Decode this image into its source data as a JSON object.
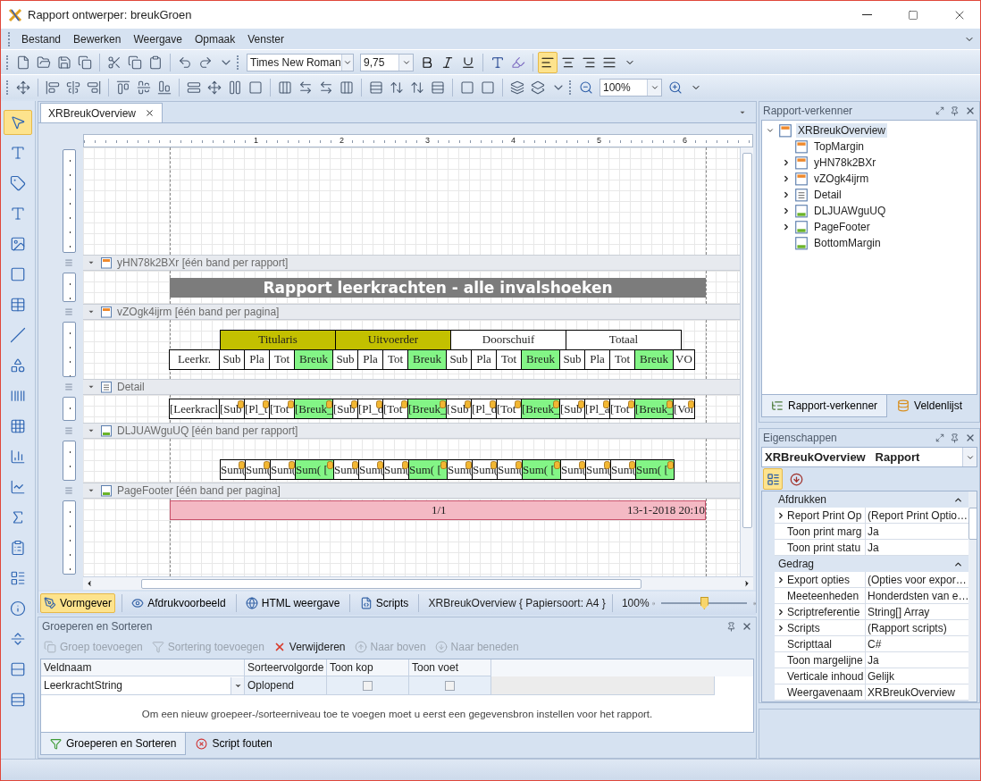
{
  "window": {
    "title": "Rapport ontwerper: breukGroen"
  },
  "menu": [
    "Bestand",
    "Bewerken",
    "Weergave",
    "Opmaak",
    "Venster"
  ],
  "toolbar": {
    "font": "Times New Roman",
    "size": "9,75",
    "zoom": "100%",
    "align_buttons": [
      {
        "selected": true
      },
      {
        "selected": false
      },
      {
        "selected": false
      },
      {
        "selected": false
      }
    ]
  },
  "toolbox": [
    {
      "selected": true
    },
    {
      "selected": false
    },
    {
      "selected": false
    },
    {
      "selected": false
    },
    {
      "selected": false
    },
    {
      "selected": false
    },
    {
      "selected": false
    },
    {
      "selected": false
    },
    {
      "selected": false
    },
    {
      "selected": false
    },
    {
      "selected": false
    },
    {
      "selected": false
    },
    {
      "selected": false
    },
    {
      "selected": false
    },
    {
      "selected": false
    },
    {
      "selected": false
    },
    {
      "selected": false
    },
    {
      "selected": false
    },
    {
      "selected": false
    },
    {
      "selected": false
    }
  ],
  "document_tab": "XRBreukOverview",
  "ruler": [
    "1",
    "2",
    "3",
    "4",
    "5",
    "6"
  ],
  "bands": [
    {
      "kind": "top-margin"
    },
    {
      "kind": "report-header",
      "label": "yHN78k2BXr [één band per rapport]",
      "title": "Rapport leerkrachten - alle invalshoeken"
    },
    {
      "kind": "page-header",
      "label": "vZOgk4ijrm [één band per pagina]",
      "groups": [
        {
          "label": "Titularis",
          "color": "#c3c000"
        },
        {
          "label": "Uitvoerder",
          "color": "#c3c000"
        },
        {
          "label": "Doorschuif",
          "color": "#ffffff"
        },
        {
          "label": "Totaal",
          "color": "#ffffff"
        }
      ],
      "cells": [
        {
          "text": "Leerkr.",
          "kind": "name"
        },
        {
          "text": "Sub",
          "kind": "value"
        },
        {
          "text": "Pla",
          "kind": "value"
        },
        {
          "text": "Tot",
          "kind": "value"
        },
        {
          "text": "Breuk",
          "kind": "fraction"
        },
        {
          "text": "Sub",
          "kind": "value"
        },
        {
          "text": "Pla",
          "kind": "value"
        },
        {
          "text": "Tot",
          "kind": "value"
        },
        {
          "text": "Breuk",
          "kind": "fraction"
        },
        {
          "text": "Sub",
          "kind": "value"
        },
        {
          "text": "Pla",
          "kind": "value"
        },
        {
          "text": "Tot",
          "kind": "value"
        },
        {
          "text": "Breuk",
          "kind": "fraction"
        },
        {
          "text": "Sub",
          "kind": "value"
        },
        {
          "text": "Pla",
          "kind": "value"
        },
        {
          "text": "Tot",
          "kind": "value"
        },
        {
          "text": "Breuk",
          "kind": "fraction"
        },
        {
          "text": "VO",
          "kind": "extra"
        }
      ]
    },
    {
      "kind": "detail",
      "label": "Detail",
      "cells": [
        {
          "text": "[Leerkracl",
          "kind": "name"
        },
        {
          "text": "[Sub",
          "kind": "value"
        },
        {
          "text": "[Pl_t",
          "kind": "value"
        },
        {
          "text": "[Tot",
          "kind": "value"
        },
        {
          "text": "[Breuk_",
          "kind": "fraction"
        },
        {
          "text": "[Sub",
          "kind": "value"
        },
        {
          "text": "[Pl_d",
          "kind": "value"
        },
        {
          "text": "[Tot",
          "kind": "value"
        },
        {
          "text": "[Breuk_",
          "kind": "fraction"
        },
        {
          "text": "[Sub",
          "kind": "value"
        },
        {
          "text": "[Pl_d",
          "kind": "value"
        },
        {
          "text": "[Tot",
          "kind": "value"
        },
        {
          "text": "[Breuk_",
          "kind": "fraction"
        },
        {
          "text": "[Sub",
          "kind": "value"
        },
        {
          "text": "[Pl_a",
          "kind": "value"
        },
        {
          "text": "[Tot",
          "kind": "value"
        },
        {
          "text": "[Breuk_",
          "kind": "fraction"
        },
        {
          "text": "[Vol",
          "kind": "extra"
        }
      ]
    },
    {
      "kind": "report-footer",
      "label": "DLJUAWguUQ [één band per rapport]",
      "cells": [
        {
          "text": "Sum(",
          "kind": "value"
        },
        {
          "text": "Sum(",
          "kind": "value"
        },
        {
          "text": "Sum(",
          "kind": "value"
        },
        {
          "text": "Sum( [",
          "kind": "fraction"
        },
        {
          "text": "Sum(",
          "kind": "value"
        },
        {
          "text": "Sum(",
          "kind": "value"
        },
        {
          "text": "Sum(",
          "kind": "value"
        },
        {
          "text": "Sum( [",
          "kind": "fraction"
        },
        {
          "text": "Sum(",
          "kind": "value"
        },
        {
          "text": "Sum(",
          "kind": "value"
        },
        {
          "text": "Sum(",
          "kind": "value"
        },
        {
          "text": "Sum( [",
          "kind": "fraction"
        },
        {
          "text": "Sum(",
          "kind": "value"
        },
        {
          "text": "Sum(",
          "kind": "value"
        },
        {
          "text": "Sum(",
          "kind": "value"
        },
        {
          "text": "Sum( [",
          "kind": "fraction"
        }
      ]
    },
    {
      "kind": "page-footer",
      "label": "PageFooter [één band per pagina]",
      "page": "1/1",
      "date": "13-1-2018 20:10"
    }
  ],
  "designer_tabs": [
    {
      "label": "Vormgever",
      "selected": true
    },
    {
      "label": "Afdrukvoorbeeld",
      "selected": false
    },
    {
      "label": "HTML weergave",
      "selected": false
    },
    {
      "label": "Scripts",
      "selected": false
    }
  ],
  "designer_status": "XRBreukOverview { Papiersoort: A4 }",
  "zoom": {
    "reading": "100%",
    "level": 0.5
  },
  "group_sort": {
    "title": "Groeperen en Sorteren",
    "actions": [
      {
        "label": "Groep toevoegen",
        "disabled": true
      },
      {
        "label": "Sortering toevoegen",
        "disabled": true
      },
      {
        "label": "Verwijderen",
        "disabled": false
      },
      {
        "label": "Naar boven",
        "disabled": true
      },
      {
        "label": "Naar beneden",
        "disabled": true
      }
    ],
    "columns": [
      "Veldnaam",
      "Sorteervolgorde",
      "Toon kop",
      "Toon voet"
    ],
    "rows": [
      {
        "field": "LeerkrachtString",
        "order": "Oplopend",
        "show_header": false,
        "show_footer": false
      }
    ],
    "message": "Om een nieuw groepeer-/sorteerniveau toe te voegen moet u eerst een gegevensbron instellen voor het rapport.",
    "tabs": [
      {
        "label": "Groeperen en Sorteren",
        "selected": true
      },
      {
        "label": "Script fouten",
        "selected": false
      }
    ]
  },
  "explorer": {
    "title": "Rapport-verkenner",
    "root": {
      "label": "XRBreukOverview",
      "expanded": true,
      "selected": true,
      "children": [
        {
          "label": "TopMargin",
          "kind": "top-margin",
          "expandable": false
        },
        {
          "label": "yHN78k2BXr",
          "kind": "report-header",
          "expandable": true
        },
        {
          "label": "vZOgk4ijrm",
          "kind": "page-header",
          "expandable": true
        },
        {
          "label": "Detail",
          "kind": "detail",
          "expandable": true
        },
        {
          "label": "DLJUAWguUQ",
          "kind": "report-footer",
          "expandable": true
        },
        {
          "label": "PageFooter",
          "kind": "page-footer",
          "expandable": true
        },
        {
          "label": "BottomMargin",
          "kind": "bottom-margin",
          "expandable": false
        }
      ]
    },
    "tabs": [
      {
        "label": "Rapport-verkenner",
        "selected": true
      },
      {
        "label": "Veldenlijst",
        "selected": false
      }
    ]
  },
  "properties": {
    "title": "Eigenschappen",
    "object": "XRBreukOverview",
    "type": "Rapport",
    "view_buttons": [
      {
        "selected": true
      },
      {
        "selected": false
      }
    ],
    "categories": [
      {
        "name": "Afdrukken",
        "rows": [
          {
            "name": "Report Print Op",
            "value": "(Report Print Optio…",
            "expandable": true
          },
          {
            "name": "Toon print marg",
            "value": "Ja",
            "expandable": false
          },
          {
            "name": "Toon print statu",
            "value": "Ja",
            "expandable": false
          }
        ]
      },
      {
        "name": "Gedrag",
        "rows": [
          {
            "name": "Export opties",
            "value": "(Opties voor expor…",
            "expandable": true
          },
          {
            "name": "Meeteenheden",
            "value": "Honderdsten van e…",
            "expandable": false
          },
          {
            "name": "Scriptreferentie",
            "value": "String[] Array",
            "expandable": true
          },
          {
            "name": "Scripts",
            "value": "(Rapport scripts)",
            "expandable": true
          },
          {
            "name": "Scripttaal",
            "value": "C#",
            "expandable": false
          },
          {
            "name": "Toon margelijne",
            "value": "Ja",
            "expandable": false
          },
          {
            "name": "Verticale inhoud",
            "value": "Gelijk",
            "expandable": false
          },
          {
            "name": "Weergavenaam",
            "value": "XRBreukOverview",
            "expandable": false
          }
        ]
      }
    ]
  }
}
